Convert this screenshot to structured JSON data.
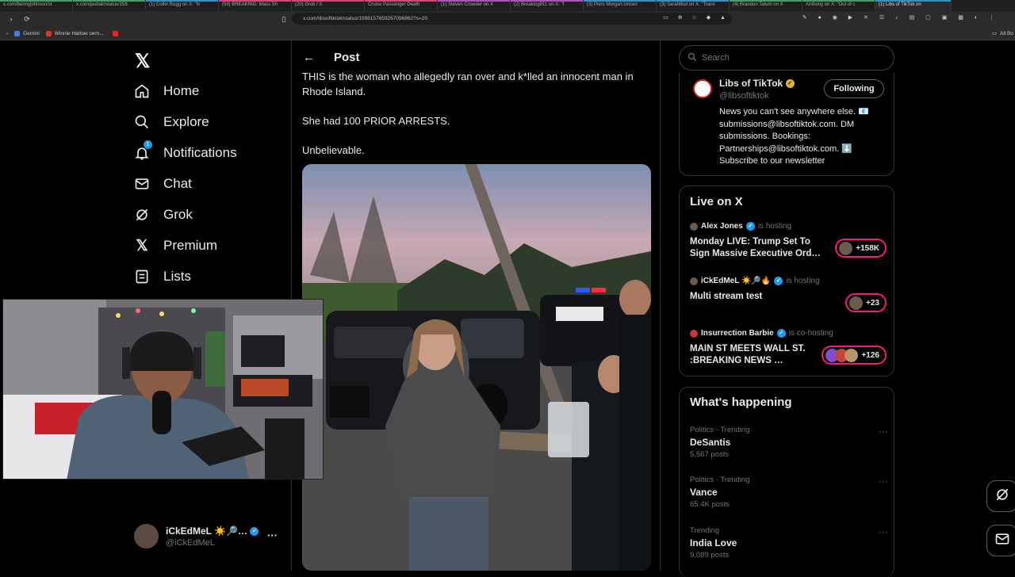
{
  "browser": {
    "tabs": [
      {
        "label": "x.com/bennyjohnson/st",
        "color": "#3ea06a"
      },
      {
        "label": "x.com/jasbair/status/159",
        "color": "#3ea06a"
      },
      {
        "label": "(1) Collin Rugg on X: \"N",
        "color": "#2f8fd6"
      },
      {
        "label": "(59) BREAKING: Mass Sh",
        "color": "#d6447a"
      },
      {
        "label": "(20) Grok / X",
        "color": "#d6447a"
      },
      {
        "label": "Cruise Passenger Death",
        "color": "#d6447a"
      },
      {
        "label": "(1) Steven Crowder on X",
        "color": "#b04fc9"
      },
      {
        "label": "(2) Breaking911 on X: \"I",
        "color": "#b04fc9"
      },
      {
        "label": "(3) Piers Morgan Uncen",
        "color": "#2f8fd6"
      },
      {
        "label": "(3) SarahBull on X: \"Trans",
        "color": "#2f8fd6"
      },
      {
        "label": "(4) Brandon Tatum on X",
        "color": "#3ea06a"
      },
      {
        "label": "Anthony on X: \"Out of c",
        "color": "#3ea06a"
      },
      {
        "label": "(1) Libs of TikTok on",
        "color": "#2f8fd6",
        "active": true
      }
    ],
    "url": "x.com/libsoftiktok/status/1998157659267096862?s=20",
    "bookmarks": [
      "Gemini",
      "Winnie Harlow cern…"
    ],
    "all_bookmarks": "All Bo"
  },
  "sidebar": {
    "items": [
      {
        "label": "Home",
        "icon": "home-icon"
      },
      {
        "label": "Explore",
        "icon": "search-icon"
      },
      {
        "label": "Notifications",
        "icon": "bell-icon",
        "badge": "1"
      },
      {
        "label": "Chat",
        "icon": "mail-icon"
      },
      {
        "label": "Grok",
        "icon": "grok-icon"
      },
      {
        "label": "Premium",
        "icon": "x-icon"
      },
      {
        "label": "Lists",
        "icon": "list-icon"
      }
    ],
    "account": {
      "name": "iCkEdMeL ☀️🔎…",
      "handle": "@iCkEdMeL",
      "more": "···"
    }
  },
  "post": {
    "header": "Post",
    "paragraphs": [
      "THIS is the woman who allegedly ran over and k*lled an innocent man in Rhode Island.",
      "She had 100 PRIOR ARRESTS.",
      "Unbelievable."
    ]
  },
  "right": {
    "search_placeholder": "Search",
    "profile": {
      "name": "Libs of TikTok",
      "handle": "@libsoftiktok",
      "follow_label": "Following",
      "bio": "News you can't see anywhere else. 📧 submissions@libsoftiktok.com. DM submissions. Bookings: Partnerships@libsoftiktok.com. ⬇️ Subscribe to our newsletter"
    },
    "live": {
      "title": "Live on X",
      "items": [
        {
          "host": "Alex Jones",
          "role": "is hosting",
          "title": "Monday LIVE: Trump Set To Sign Massive Executive Ord…",
          "count": "+158K"
        },
        {
          "host": "iCkEdMeL ☀️🔎🔥",
          "role": "is hosting",
          "title": "Multi stream test",
          "count": "+23"
        },
        {
          "host": "Insurrection Barbie",
          "role": "is co-hosting",
          "title": "MAIN ST MEETS WALL ST. :BREAKING NEWS …",
          "count": "+126"
        }
      ]
    },
    "happening": {
      "title": "What's happening",
      "trends": [
        {
          "category": "Politics · Trending",
          "name": "DeSantis",
          "posts": "5,567 posts"
        },
        {
          "category": "Politics · Trending",
          "name": "Vance",
          "posts": "65.4K posts"
        },
        {
          "category": "Trending",
          "name": "India Love",
          "posts": "9,089 posts"
        }
      ]
    }
  },
  "colors": {
    "accent": "#1d9bf0",
    "live_ring": "#f91880",
    "verified_gold": "#e0b336"
  }
}
